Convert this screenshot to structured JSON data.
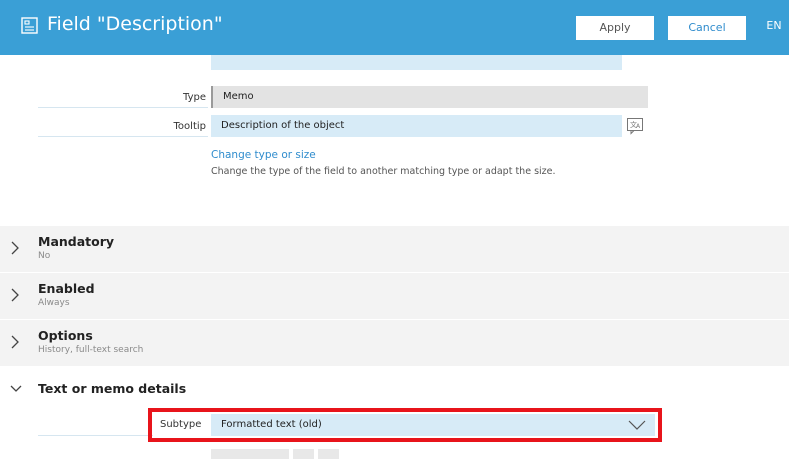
{
  "header": {
    "title": "Field \"Description\"",
    "apply_label": "Apply",
    "cancel_label": "Cancel",
    "language": "EN"
  },
  "fields": {
    "type_label": "Type",
    "type_value": "Memo",
    "tooltip_label": "Tooltip",
    "tooltip_value": "Description of the object"
  },
  "change": {
    "link_text": "Change type or size",
    "description": "Change the type of the field to another matching type or adapt the size."
  },
  "sections": [
    {
      "title": "Mandatory",
      "subtitle": "No",
      "expanded": false
    },
    {
      "title": "Enabled",
      "subtitle": "Always",
      "expanded": false
    },
    {
      "title": "Options",
      "subtitle": "History, full-text search",
      "expanded": false
    },
    {
      "title": "Text or memo details",
      "subtitle": "",
      "expanded": true
    }
  ],
  "text_details": {
    "subtype_label": "Subtype",
    "subtype_value": "Formatted text (old)"
  },
  "colors": {
    "header_bg": "#3a9fd6",
    "input_bg": "#d7ebf7",
    "highlight": "#e8141b",
    "link": "#2f8ccd"
  },
  "icons": {
    "title": "form-icon",
    "tooltip": "translate-icon",
    "collapsed": "chevron-right-icon",
    "expanded": "chevron-down-icon",
    "dropdown": "chevron-down-icon"
  }
}
